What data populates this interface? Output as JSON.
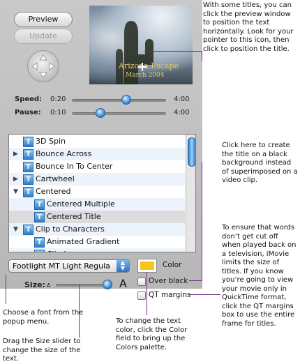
{
  "buttons": {
    "preview": "Preview",
    "update": "Update"
  },
  "preview_title": {
    "line1": "Arizona Escape",
    "line2": "March 2004"
  },
  "sliders": {
    "speed": {
      "label": "Speed:",
      "min": "0:20",
      "max": "4:00",
      "position": 0.58
    },
    "pause": {
      "label": "Pause:",
      "min": "0:10",
      "max": "4:00",
      "position": 0.3
    }
  },
  "titles_list": [
    {
      "label": "3D Spin",
      "indent": 0,
      "toggle": ""
    },
    {
      "label": "Bounce Across",
      "indent": 0,
      "toggle": "right"
    },
    {
      "label": "Bounce In To Center",
      "indent": 0,
      "toggle": ""
    },
    {
      "label": "Cartwheel",
      "indent": 0,
      "toggle": "right"
    },
    {
      "label": "Centered",
      "indent": 0,
      "toggle": "down"
    },
    {
      "label": "Centered Multiple",
      "indent": 1,
      "toggle": ""
    },
    {
      "label": "Centered Title",
      "indent": 1,
      "toggle": "",
      "selected": true
    },
    {
      "label": "Clip to Characters",
      "indent": 0,
      "toggle": "down"
    },
    {
      "label": "Animated Gradient",
      "indent": 1,
      "toggle": ""
    },
    {
      "label": "Clip Image",
      "indent": 1,
      "toggle": ""
    }
  ],
  "font_popup": {
    "value": "Footlight MT Light Regula"
  },
  "color": {
    "label": "Color",
    "swatch": "#f2c61a"
  },
  "size": {
    "label": "Size:",
    "small": "A",
    "large": "A",
    "position": 0.92
  },
  "checkboxes": {
    "over_black": "Over black",
    "qt_margins": "QT margins"
  },
  "annotations": {
    "preview": "With some titles, you can click the preview window to position the text horizontally. Look for your pointer to this icon, then click to position the title.",
    "over_black": "Click here to create the title on a black background instead of superimposed on a video clip.",
    "qt_margins": "To ensure that words don’t get cut off when played back on a television, iMovie limits the size of titles. If you know you’re going to view your movie only in QuickTime format, click the QT margins box to use the entire frame for titles.",
    "font": "Choose a font from the popup menu.",
    "size": "Drag the Size slider to change the size of the text.",
    "color": "To change the text color, click the Color field to bring up the Colors palette."
  },
  "theme": {
    "accent": "#7a2a8a",
    "selection": "#dcdcdc"
  }
}
